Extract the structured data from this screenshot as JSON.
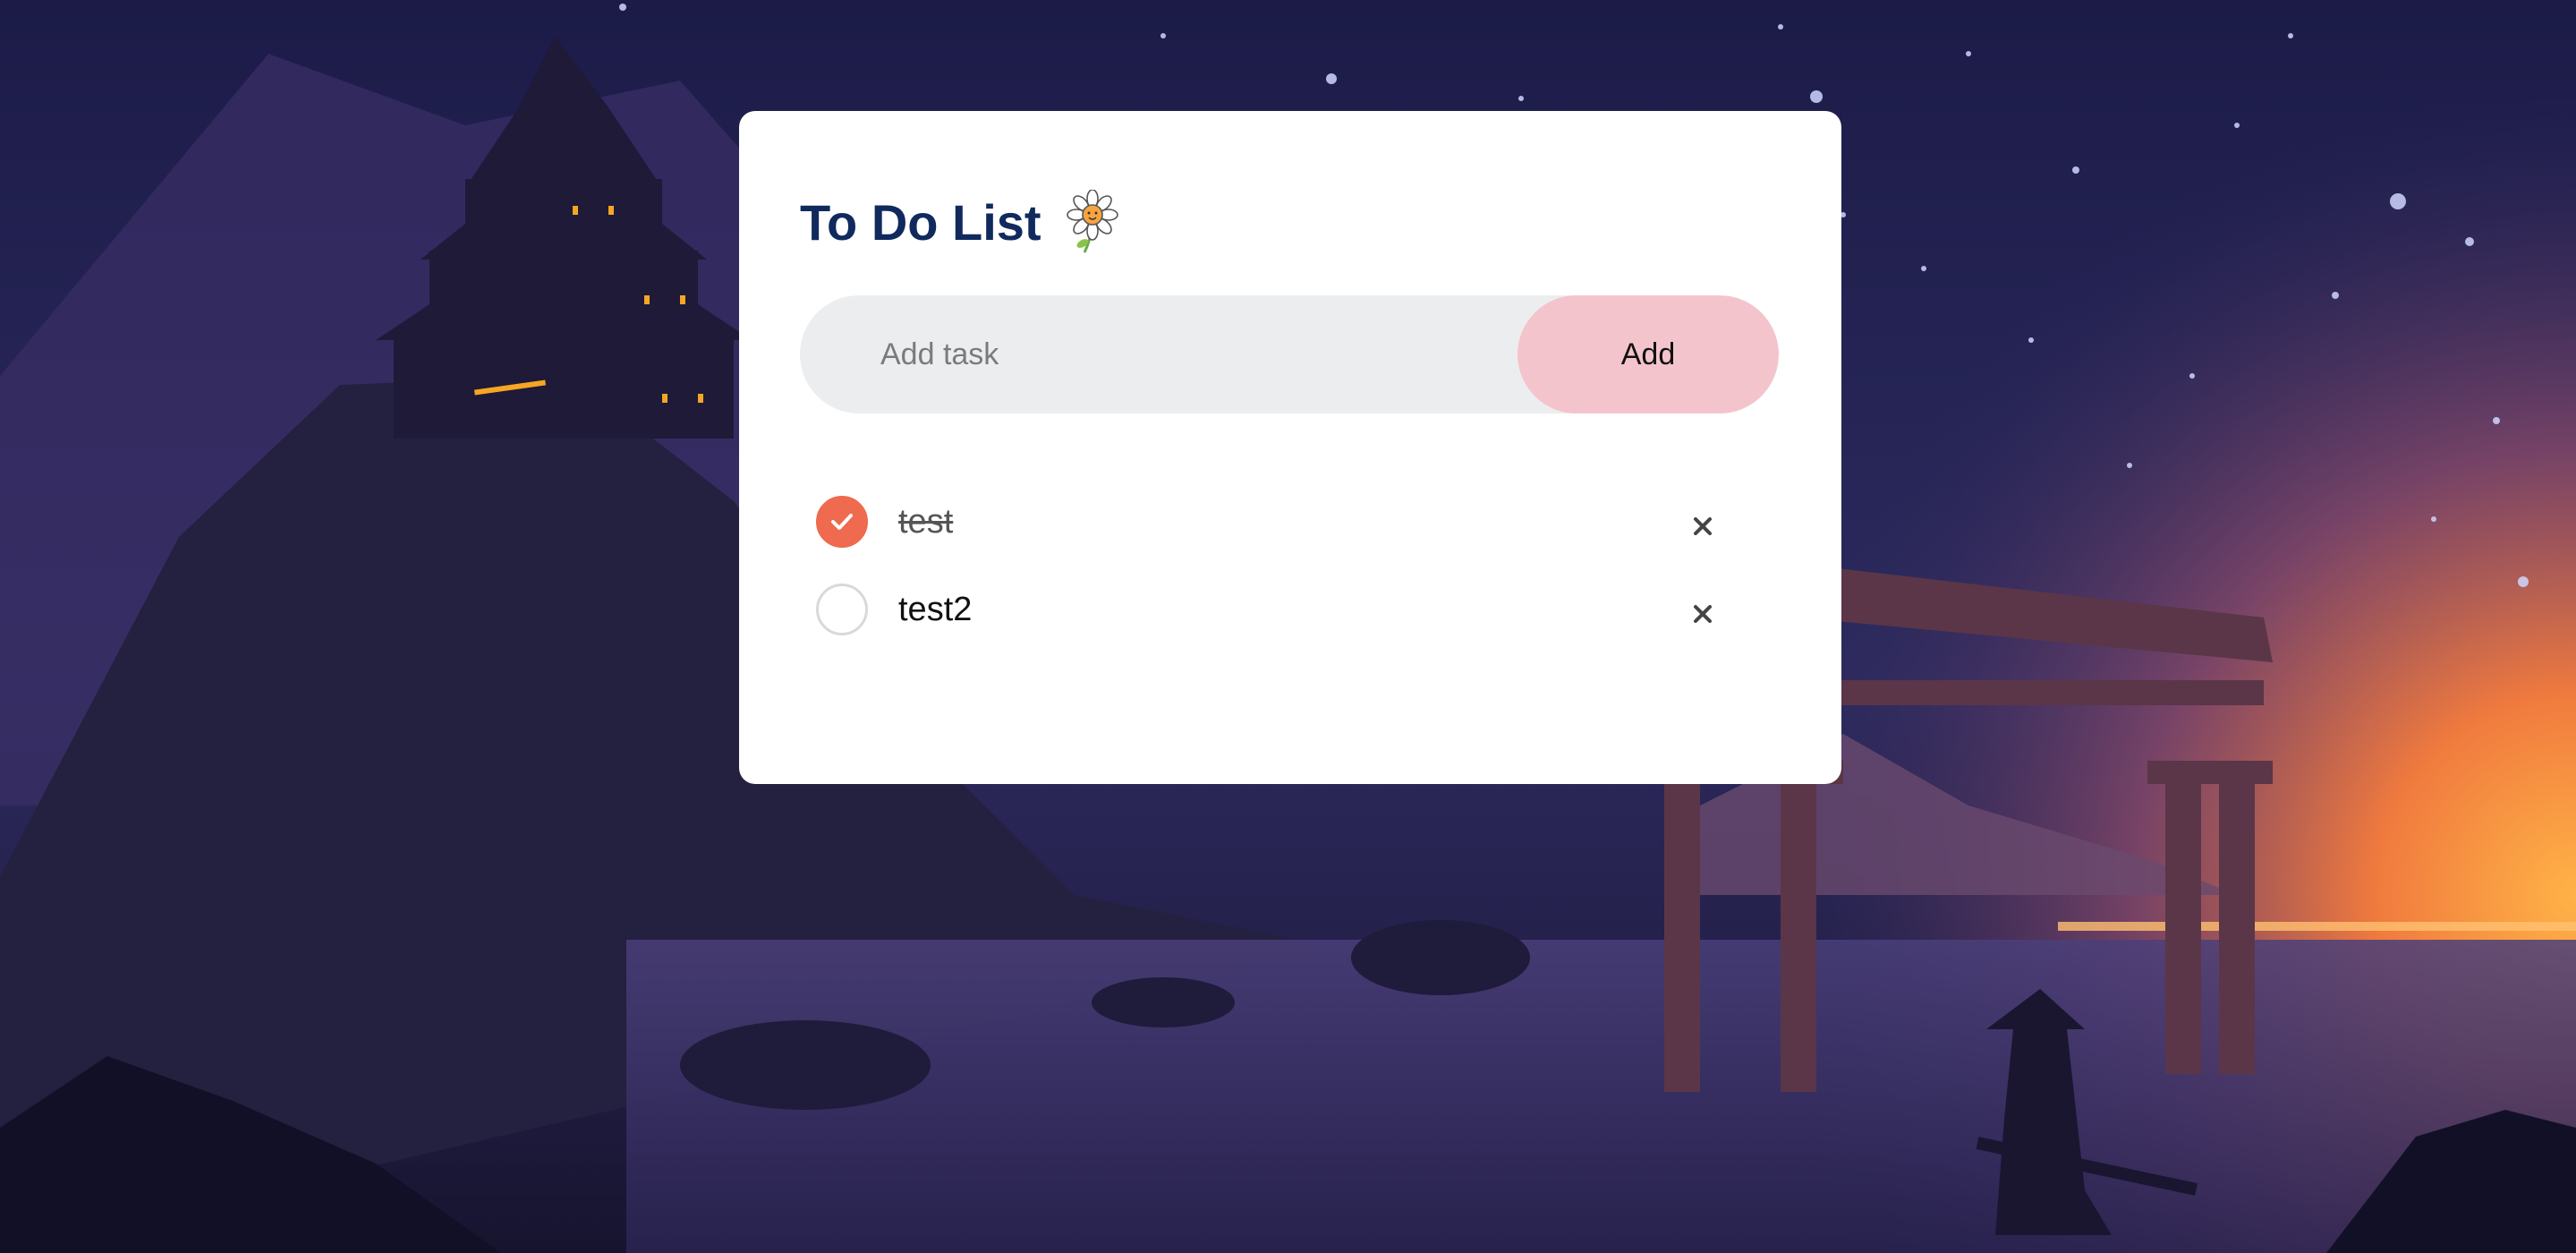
{
  "header": {
    "title": "To Do List",
    "icon": "daisy-icon"
  },
  "input": {
    "placeholder": "Add task",
    "value": ""
  },
  "add_button": {
    "label": "Add"
  },
  "tasks": [
    {
      "label": "test",
      "completed": true
    },
    {
      "label": "test2",
      "completed": false
    }
  ],
  "colors": {
    "title": "#102a5e",
    "check_done": "#ef6a4f",
    "add_button": "#f4c4cc",
    "input_bg": "#ecedef"
  }
}
